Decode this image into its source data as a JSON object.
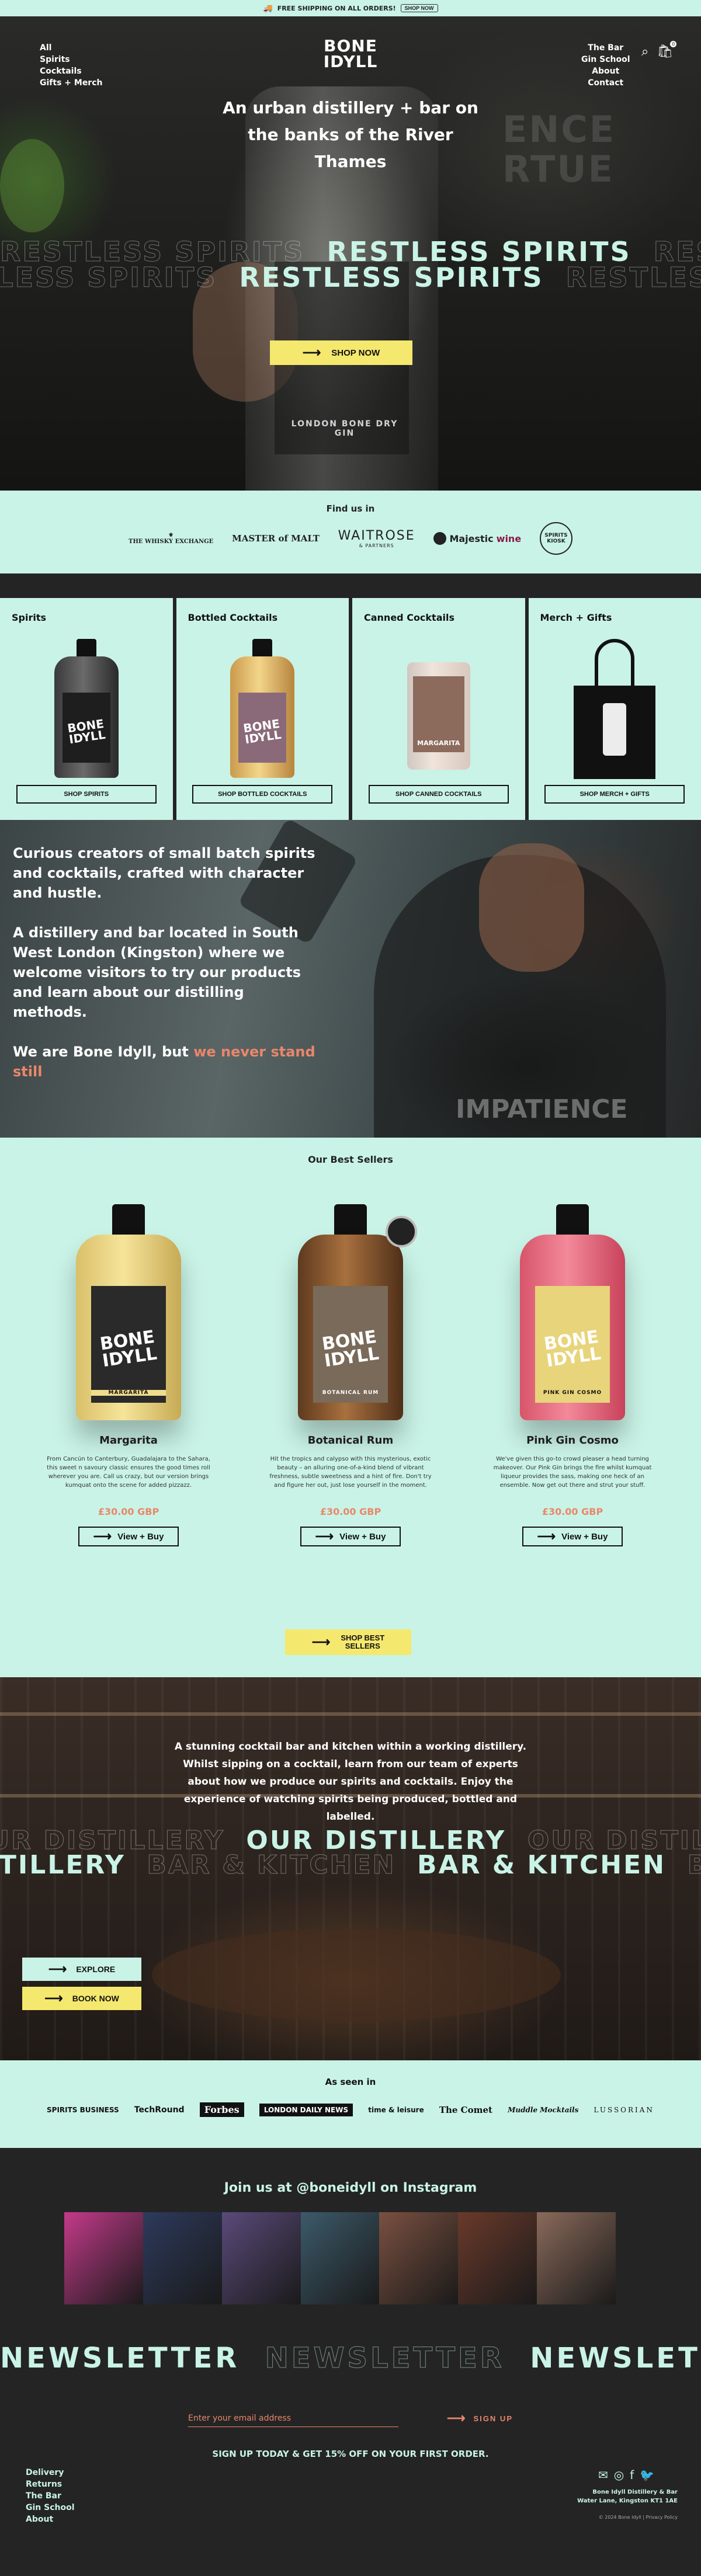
{
  "announcement": {
    "text": "FREE SHIPPING ON ALL ORDERS!",
    "button": "SHOP NOW"
  },
  "nav": {
    "left": [
      "All",
      "Spirits",
      "Cocktails",
      "Gifts + Merch"
    ],
    "right": [
      "The Bar",
      "Gin School",
      "About",
      "Contact"
    ],
    "logo_line1": "BONE",
    "logo_line2": "IDYLL",
    "cart_count": "0"
  },
  "hero": {
    "heading": "An urban distillery + bar on the banks of the River Thames",
    "marquee_text": "RESTLESS SPIRITS",
    "cta": "SHOP NOW",
    "bottle_text": "LONDON BONE DRY GIN"
  },
  "find_us": {
    "title": "Find us in",
    "brands": [
      "THE WHISKY EXCHANGE",
      "MASTER of MALT",
      "WAITROSE",
      "& PARTNERS",
      "Majestic",
      "wine",
      "SPIRITS KIOSK"
    ]
  },
  "categories": [
    {
      "title": "Spirits",
      "cta": "SHOP SPIRITS"
    },
    {
      "title": "Bottled Cocktails",
      "cta": "SHOP BOTTLED COCKTAILS"
    },
    {
      "title": "Canned Cocktails",
      "cta": "SHOP CANNED COCKTAILS"
    },
    {
      "title": "Merch + Gifts",
      "cta": "SHOP MERCH + GIFTS"
    }
  ],
  "can_label": "MARGARITA",
  "bottle_brand": "BONE IDYLL",
  "story": {
    "p1": "Curious creators of small batch spirits and cocktails, crafted with character and hustle.",
    "p2": "A distillery and bar located in South West London (Kingston) where we welcome visitors to try our products and learn about our distilling methods.",
    "p3_prefix": "We are Bone Idyll, but ",
    "p3_highlight": "we never stand still",
    "shirt_text": "IMPATIENCE"
  },
  "best_sellers": {
    "title": "Our Best Sellers",
    "products": [
      {
        "name": "Margarita",
        "label": "MARGARITA",
        "description": "From Cancún to Canterbury, Guadalajara to the Sahara, this sweet n savoury classic ensures the good times roll wherever you are. Call us crazy, but our version brings kumquat onto the scene for added pizzazz.",
        "price": "£30.00 GBP",
        "cta": "View + Buy"
      },
      {
        "name": "Botanical Rum",
        "label": "BOTANICAL RUM",
        "description": "Hit the tropics and calypso with this mysterious, exotic beauty – an alluring one-of-a-kind blend of vibrant freshness, subtle sweetness and a hint of fire. Don't try and figure her out, just lose yourself in the moment.",
        "price": "£30.00 GBP",
        "cta": "View + Buy"
      },
      {
        "name": "Pink Gin Cosmo",
        "label": "PINK GIN COSMO",
        "description": "We've given this go-to crowd pleaser a head turning makeover. Our Pink Gin brings the fire whilst kumquat liqueur provides the sass, making one heck of an ensemble. Now get out there and strut your stuff.",
        "price": "£30.00 GBP",
        "cta": "View + Buy"
      }
    ],
    "cta_line1": "SHOP BEST",
    "cta_line2": "SELLERS"
  },
  "distillery": {
    "text": "A stunning cocktail bar and kitchen within a working distillery. Whilst sipping on a cocktail, learn from our team of experts about how we produce our spirits and cocktails. Enjoy the experience of watching spirits being produced, bottled and labelled.",
    "marquee1": "OUR DISTILLERY",
    "marquee2": "BAR & KITCHEN",
    "explore": "EXPLORE",
    "book": "BOOK NOW"
  },
  "as_seen_in": {
    "title": "As seen in",
    "logos": [
      "SPIRITS BUSINESS",
      "TechRound",
      "Forbes",
      "LONDON DAILY NEWS",
      "time & leisure",
      "The Comet",
      "Muddle Mocktails",
      "LUSSORIAN"
    ]
  },
  "instagram": {
    "title": "Join us at @boneidyll on Instagram",
    "tile_colors": [
      "#c33a8a",
      "#2d3a5c",
      "#5a4a7a",
      "#3c5a6a",
      "#7a5040",
      "#6a3a2a",
      "#8a6a5a"
    ]
  },
  "newsletter": {
    "marquee": "NEWSLETTER",
    "placeholder": "Enter your email address",
    "signup": "SIGN UP",
    "offer": "SIGN UP TODAY & GET 15% OFF ON YOUR FIRST ORDER."
  },
  "footer": {
    "links": [
      "Delivery",
      "Returns",
      "The Bar",
      "Gin School",
      "About"
    ],
    "address_line1": "Bone Idyll Distillery & Bar",
    "address_line2": "Water Lane, Kingston KT1 1AE",
    "copyright": "© 2024 Bone Idyll | Privacy Policy"
  },
  "colors": {
    "mint": "#c9f3e6",
    "yellow": "#f5e86e",
    "coral": "#e9876b",
    "dark": "#242424"
  }
}
